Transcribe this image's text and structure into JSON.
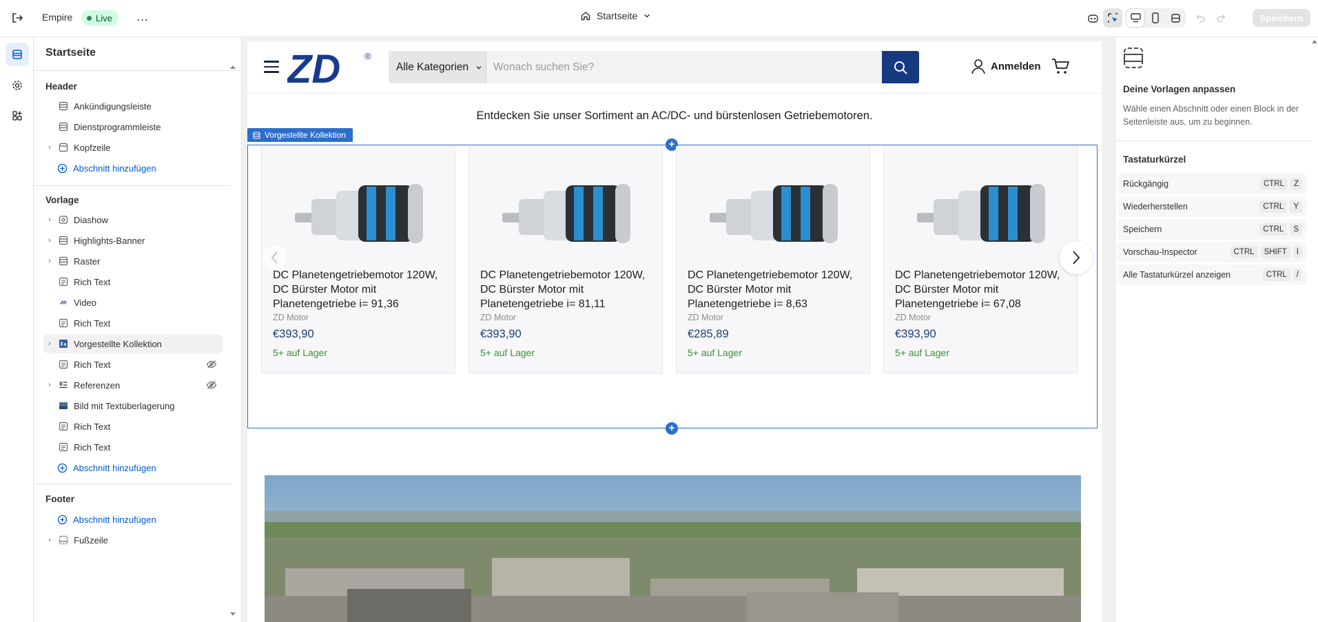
{
  "topbar": {
    "theme_name": "Empire",
    "live_label": "Live",
    "more_label": "…",
    "page_selector": "Startseite",
    "save_label": "Speichern"
  },
  "sidebar": {
    "title": "Startseite",
    "header_section": {
      "title": "Header",
      "items": [
        {
          "label": "Ankündigungsleiste",
          "icon": "section-icon",
          "expandable": false
        },
        {
          "label": "Dienstprogrammleiste",
          "icon": "section-icon",
          "expandable": false
        },
        {
          "label": "Kopfzeile",
          "icon": "section-icon",
          "expandable": true
        }
      ],
      "add_label": "Abschnitt hinzufügen"
    },
    "template_section": {
      "title": "Vorlage",
      "items": [
        {
          "label": "Diashow",
          "icon": "slideshow-icon",
          "expandable": true,
          "hidden": false
        },
        {
          "label": "Highlights-Banner",
          "icon": "section-icon",
          "expandable": true,
          "hidden": false
        },
        {
          "label": "Raster",
          "icon": "section-icon",
          "expandable": true,
          "hidden": false
        },
        {
          "label": "Rich Text",
          "icon": "text-icon",
          "expandable": false,
          "hidden": false
        },
        {
          "label": "Video",
          "icon": "video-icon",
          "expandable": false,
          "hidden": false
        },
        {
          "label": "Rich Text",
          "icon": "text-icon",
          "expandable": false,
          "hidden": false
        },
        {
          "label": "Vorgestellte Kollektion",
          "icon": "collection-icon",
          "expandable": true,
          "hidden": false,
          "selected": true
        },
        {
          "label": "Rich Text",
          "icon": "text-icon",
          "expandable": false,
          "hidden": true
        },
        {
          "label": "Referenzen",
          "icon": "testimonial-icon",
          "expandable": true,
          "hidden": true
        },
        {
          "label": "Bild mit Textüberlagerung",
          "icon": "image-icon",
          "expandable": false,
          "hidden": false
        },
        {
          "label": "Rich Text",
          "icon": "text-icon",
          "expandable": false,
          "hidden": false
        },
        {
          "label": "Rich Text",
          "icon": "text-icon",
          "expandable": false,
          "hidden": false
        }
      ],
      "add_label": "Abschnitt hinzufügen"
    },
    "footer_section": {
      "title": "Footer",
      "add_label": "Abschnitt hinzufügen",
      "items": [
        {
          "label": "Fußzeile",
          "icon": "section-icon",
          "expandable": true
        }
      ]
    }
  },
  "preview": {
    "logo_text": "ZD",
    "logo_mark": "®",
    "search": {
      "category": "Alle Kategorien",
      "placeholder": "Wonach suchen Sie?"
    },
    "login_label": "Anmelden",
    "tagline": "Entdecken Sie unser Sortiment an AC/DC- und bürstenlosen Getriebemotoren.",
    "section_label": "Vorgestellte Kollektion",
    "products": [
      {
        "title": "DC Planetengetriebemotor 120W, DC Bürster Motor mit Planetengetriebe i= 91,36",
        "vendor": "ZD Motor",
        "price": "€393,90",
        "stock": "5+ auf Lager"
      },
      {
        "title": "DC Planetengetriebemotor 120W, DC Bürster Motor mit Planetengetriebe i= 81,11",
        "vendor": "ZD Motor",
        "price": "€393,90",
        "stock": "5+ auf Lager"
      },
      {
        "title": "DC Planetengetriebemotor 120W, DC Bürster Motor mit Planetengetriebe i= 8,63",
        "vendor": "ZD Motor",
        "price": "€285,89",
        "stock": "5+ auf Lager"
      },
      {
        "title": "DC Planetengetriebemotor 120W, DC Bürster Motor mit Planetengetriebe i= 67,08",
        "vendor": "ZD Motor",
        "price": "€393,90",
        "stock": "5+ auf Lager"
      }
    ]
  },
  "right_panel": {
    "heading": "Deine Vorlagen anpassen",
    "description": "Wähle einen Abschnitt oder einen Block in der Seitenleiste aus, um zu beginnen.",
    "shortcuts_title": "Tastaturkürzel",
    "shortcuts": [
      {
        "label": "Rückgängig",
        "keys": [
          "CTRL",
          "Z"
        ]
      },
      {
        "label": "Wiederherstellen",
        "keys": [
          "CTRL",
          "Y"
        ]
      },
      {
        "label": "Speichern",
        "keys": [
          "CTRL",
          "S"
        ]
      },
      {
        "label": "Vorschau-Inspector",
        "keys": [
          "CTRL",
          "SHIFT",
          "I"
        ]
      },
      {
        "label": "Alle Tastaturkürzel anzeigen",
        "keys": [
          "CTRL",
          "/"
        ]
      }
    ]
  },
  "colors": {
    "accent": "#005bd3",
    "live_bg": "#cdfee1",
    "selection_blue": "#2c6ecb",
    "brand_navy": "#163a80",
    "stock_green": "#3f8f3a"
  }
}
